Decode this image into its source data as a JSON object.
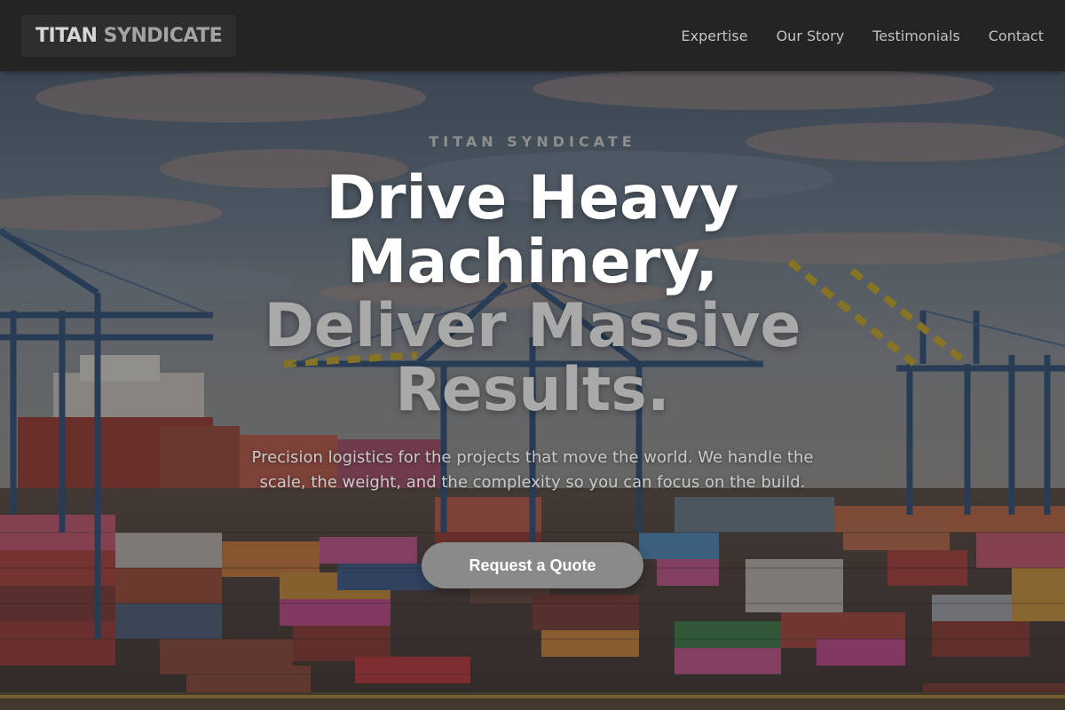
{
  "brand": {
    "name_part1": "TITAN",
    "name_part2": "SYNDICATE"
  },
  "nav": {
    "links": [
      "Expertise",
      "Our Story",
      "Testimonials",
      "Contact"
    ]
  },
  "hero": {
    "eyebrow": "TITAN SYNDICATE",
    "headline_line1": "Drive Heavy",
    "headline_line2": "Machinery,",
    "headline_line3": "Deliver Massive",
    "headline_line4": "Results.",
    "subtext": "Precision logistics for the projects that move the world. We handle the scale, the weight, and the complexity so you can focus on the build.",
    "cta_label": "Request a Quote",
    "background_image": "container-port-with-cranes"
  },
  "colors": {
    "nav_bg": "#242424",
    "headline_primary": "#ffffff",
    "headline_secondary": "#a9a9a9",
    "cta_bg": "#8a8a8a"
  }
}
